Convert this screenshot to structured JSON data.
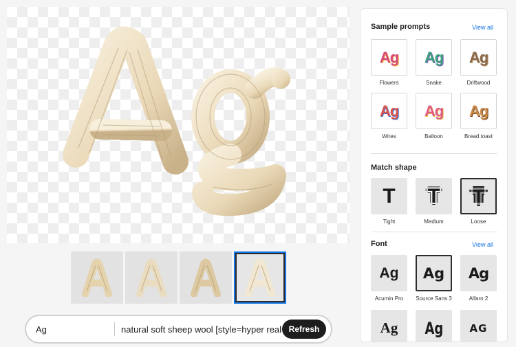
{
  "preview": {
    "letters": "Ag"
  },
  "thumbnails": [
    {
      "letter": "A",
      "selected": false
    },
    {
      "letter": "A",
      "selected": false
    },
    {
      "letter": "A",
      "selected": false
    },
    {
      "letter": "A",
      "selected": true
    }
  ],
  "prompt": {
    "text_value": "Ag",
    "style_value": "natural soft sheep wool [style=hyper realistic]",
    "refresh_label": "Refresh"
  },
  "sample_prompts": {
    "title": "Sample prompts",
    "view_all": "View all",
    "items": [
      {
        "label": "Flowers",
        "glyph": "Ag",
        "colors": [
          "#d64a7a",
          "#f2b43c"
        ]
      },
      {
        "label": "Snake",
        "glyph": "Ag",
        "colors": [
          "#3aa17e",
          "#8b5fbf"
        ]
      },
      {
        "label": "Driftwood",
        "glyph": "Ag",
        "colors": [
          "#8a6a4a",
          "#b99a78"
        ]
      },
      {
        "label": "Wires",
        "glyph": "Ag",
        "colors": [
          "#d9534f",
          "#3a7bd5"
        ]
      },
      {
        "label": "Balloon",
        "glyph": "Ag",
        "colors": [
          "#e05a8a",
          "#e8c04a"
        ]
      },
      {
        "label": "Bread toast",
        "glyph": "Ag",
        "colors": [
          "#c98a4a",
          "#7a4a22"
        ]
      }
    ]
  },
  "match_shape": {
    "title": "Match shape",
    "items": [
      {
        "label": "Tight",
        "glyph": "T",
        "selected": false
      },
      {
        "label": "Medium",
        "glyph": "T",
        "selected": false
      },
      {
        "label": "Loose",
        "glyph": "T",
        "selected": true
      }
    ]
  },
  "font": {
    "title": "Font",
    "view_all": "View all",
    "items": [
      {
        "label": "Acumin Pro",
        "glyph": "Ag",
        "selected": false
      },
      {
        "label": "Source Sans 3",
        "glyph": "Ag",
        "selected": true
      },
      {
        "label": "Alfarn 2",
        "glyph": "Ag",
        "selected": false
      },
      {
        "label": "",
        "glyph": "Ag",
        "selected": false
      },
      {
        "label": "",
        "glyph": "Ag",
        "selected": false
      },
      {
        "label": "",
        "glyph": "AG",
        "selected": false
      }
    ]
  },
  "colors": {
    "accent": "#1473e6",
    "button": "#1d1d1d",
    "wool": "#efe2c7"
  }
}
